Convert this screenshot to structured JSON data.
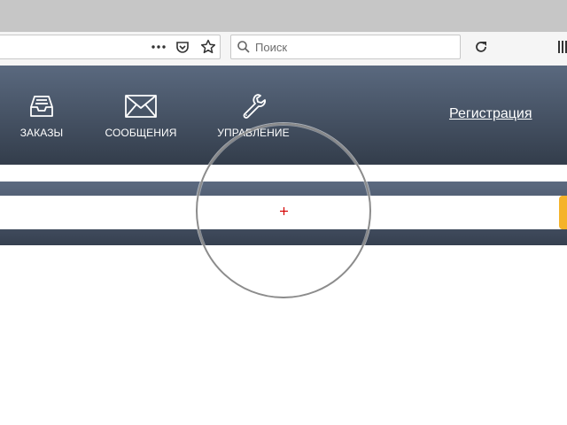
{
  "browser": {
    "search_placeholder": "Поиск",
    "page_actions": [
      "more-dots-icon",
      "pocket-icon",
      "bookmark-star-icon"
    ],
    "reload_icon": "reload-icon",
    "library_icon": "library-icon"
  },
  "nav": {
    "items": [
      {
        "label": "ЗАКАЗЫ",
        "icon": "inbox-tray-icon"
      },
      {
        "label": "СООБЩЕНИЯ",
        "icon": "envelope-icon"
      },
      {
        "label": "УПРАВЛЕНИЕ",
        "icon": "wrench-icon"
      }
    ],
    "register_label": "Регистрация"
  },
  "search": {
    "value": "",
    "submit_color": "#f5b32a"
  },
  "overlay": {
    "crosshair_color": "#d40000",
    "header_gradient": [
      "#5a697f",
      "#333d4b"
    ]
  }
}
